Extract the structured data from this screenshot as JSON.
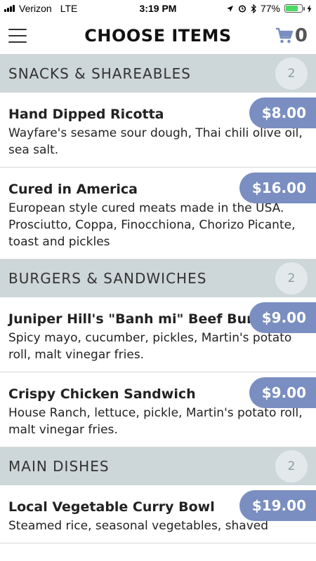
{
  "status_bar": {
    "carrier": "Verizon",
    "network": "LTE",
    "time": "3:19 PM",
    "battery_pct": "77%",
    "battery_level": 0.77,
    "battery_color": "#4cd964"
  },
  "header": {
    "title": "CHOOSE ITEMS",
    "cart_count": "0",
    "menu_icon": "hamburger-icon",
    "cart_icon": "cart-icon"
  },
  "colors": {
    "accent": "#7a8ec1",
    "section_bg": "#cdd6d8"
  },
  "sections": [
    {
      "title": "SNACKS & SHAREABLES",
      "count": "2",
      "items": [
        {
          "name": "Hand Dipped Ricotta",
          "desc": "Wayfare's sesame sour dough, Thai chili olive oil, sea salt.",
          "price": "$8.00"
        },
        {
          "name": "Cured in America",
          "desc": "European style cured meats made in the USA. Prosciutto, Coppa, Finocchiona, Chorizo Picante, toast and pickles",
          "price": "$16.00"
        }
      ]
    },
    {
      "title": "BURGERS & SANDWICHES",
      "count": "2",
      "items": [
        {
          "name": "Juniper Hill's \"Banh mi\" Beef Burger",
          "desc": "Spicy mayo, cucumber, pickles, Martin's potato roll, malt vinegar fries.",
          "price": "$9.00"
        },
        {
          "name": "Crispy Chicken Sandwich",
          "desc": "House Ranch, lettuce, pickle, Martin's potato roll, malt vinegar fries.",
          "price": "$9.00"
        }
      ]
    },
    {
      "title": "MAIN DISHES",
      "count": "2",
      "items": [
        {
          "name": "Local Vegetable Curry Bowl",
          "desc": "Steamed rice, seasonal vegetables, shaved",
          "price": "$19.00"
        }
      ]
    }
  ]
}
